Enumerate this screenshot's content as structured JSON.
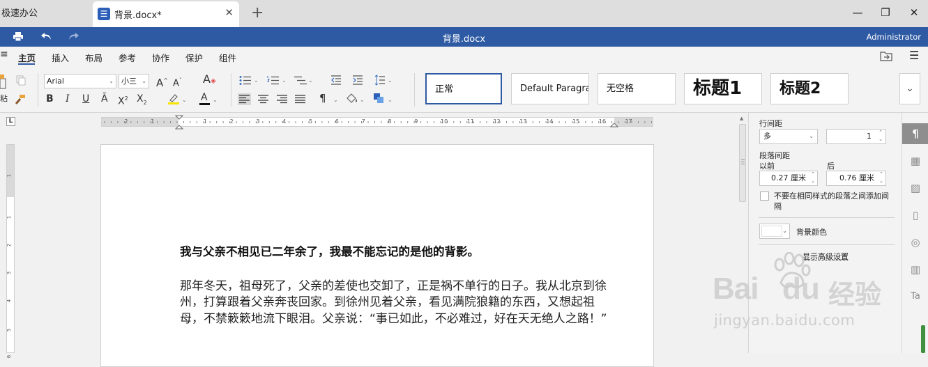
{
  "tabs": {
    "home": "极速办公",
    "doc_title": "背景.docx*",
    "doc_icon": "document-icon",
    "close": "✕",
    "new_tab": "+"
  },
  "window": {
    "minimize": "—",
    "restore": "❐",
    "close": "✕"
  },
  "titlebar": {
    "title": "背景.docx",
    "user": "Administrator"
  },
  "menu": {
    "items": [
      "主页",
      "插入",
      "布局",
      "参考",
      "协作",
      "保护",
      "组件"
    ],
    "active": "主页"
  },
  "toolbar": {
    "font_name": "Arial",
    "font_size": "小三",
    "paste_label": "粘",
    "styles": [
      "正常",
      "Default Paragraph",
      "无空格",
      "标题1",
      "标题2"
    ]
  },
  "document": {
    "title": "我与父亲不相见已二年余了，我最不能忘记的是他的背影。",
    "paragraph": "那年冬天，祖母死了，父亲的差使也交卸了，正是祸不单行的日子。我从北京到徐州，打算跟着父亲奔丧回家。到徐州见着父亲，看见满院狼籍的东西，又想起祖母，不禁簌簌地流下眼泪。父亲说：“事已如此，不必难过，好在天无绝人之路！”"
  },
  "panel": {
    "line_spacing_label": "行间距",
    "line_spacing_mode": "多",
    "line_spacing_value": "1",
    "paragraph_spacing_label": "段落间距",
    "before_label": "以前",
    "after_label": "后",
    "before_value": "0.27 厘米",
    "after_value": "0.76 厘米",
    "checkbox_label": "不要在相同样式的段落之间添加间隔",
    "background_color_label": "背景颜色",
    "advanced_settings": "显示高级设置"
  },
  "ruler": {
    "h_labels": [
      "2",
      "1",
      "1",
      "2",
      "3",
      "4",
      "5",
      "6",
      "7",
      "8",
      "9",
      "10",
      "11",
      "12",
      "13",
      "14",
      "15",
      "16",
      "17"
    ],
    "v_labels": [
      "1",
      "1",
      "2",
      "3",
      "4",
      "5",
      "6"
    ]
  },
  "watermark": {
    "brand": "Bai",
    "brand2": "du",
    "cn": "经验",
    "url": "jingyan.baidu.com"
  },
  "colors": {
    "accent": "#2e5aa4",
    "highlight": "#f5e500",
    "font_color": "#222222"
  }
}
